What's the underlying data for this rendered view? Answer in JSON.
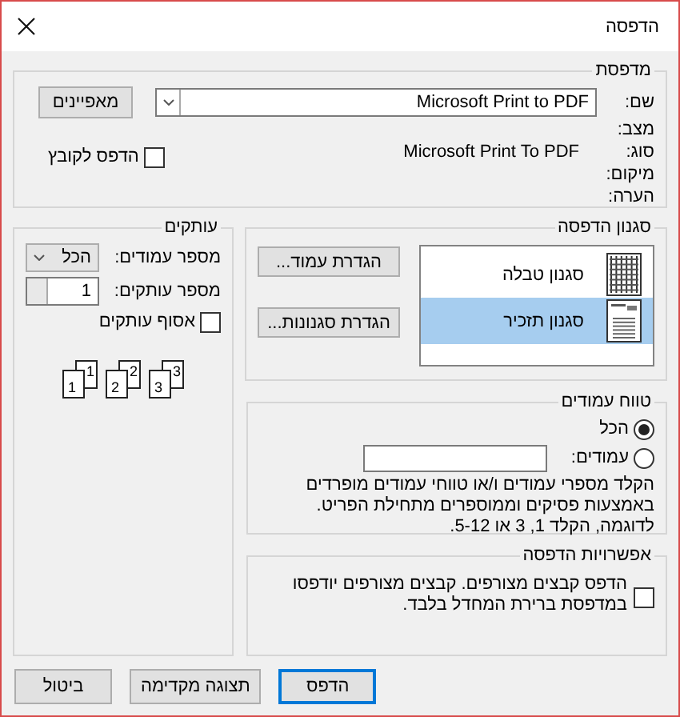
{
  "window": {
    "title": "הדפסה"
  },
  "printer": {
    "title": "מדפסת",
    "name_label": "שם:",
    "name_value": "Microsoft Print to PDF",
    "properties_button": "מאפיינים",
    "fields": [
      {
        "label": "מצב:"
      },
      {
        "label": "סוג:",
        "value": "Microsoft Print To PDF"
      },
      {
        "label": "מיקום:"
      },
      {
        "label": "הערה:"
      }
    ],
    "print_to_file": {
      "label": "הדפס לקובץ",
      "checked": false
    }
  },
  "print_style": {
    "title": "סגנון הדפסה",
    "styles": [
      {
        "label": "סגנון טבלה",
        "kind": "table",
        "selected": false
      },
      {
        "label": "סגנון תזכיר",
        "kind": "memo",
        "selected": true
      }
    ],
    "buttons": [
      "הגדרת עמוד...",
      "הגדרת סגנונות..."
    ]
  },
  "copies": {
    "title": "עותקים",
    "pages_label": "מספר עמודים:",
    "pages_value": "הכל",
    "copies_label": "מספר עותקים:",
    "copies_value": "1",
    "collate": {
      "label": "אסוף עותקים",
      "checked": false
    },
    "collate_stacks": [
      {
        "back": "3",
        "front": "3"
      },
      {
        "back": "2",
        "front": "2"
      },
      {
        "back": "1",
        "front": "1"
      }
    ]
  },
  "page_range": {
    "title": "טווח עמודים",
    "options": [
      {
        "label": "הכל",
        "selected": true
      },
      {
        "label": "עמודים:",
        "selected": false
      }
    ],
    "hint": "הקלד מספרי עמודים ו/או טווחי עמודים מופרדים באמצעות פסיקים וממוספרים מתחילת הפריט. לדוגמה, הקלד 1, 3 או 5-12."
  },
  "print_options": {
    "title": "אפשרויות הדפסה",
    "attachments": {
      "label": "הדפס קבצים מצורפים. קבצים מצורפים יודפסו במדפסת ברירת המחדל בלבד.",
      "checked": false
    }
  },
  "buttons": [
    {
      "label": "הדפס",
      "default": true
    },
    {
      "label": "תצוגה מקדימה",
      "default": false
    },
    {
      "label": "ביטול",
      "default": false
    }
  ]
}
